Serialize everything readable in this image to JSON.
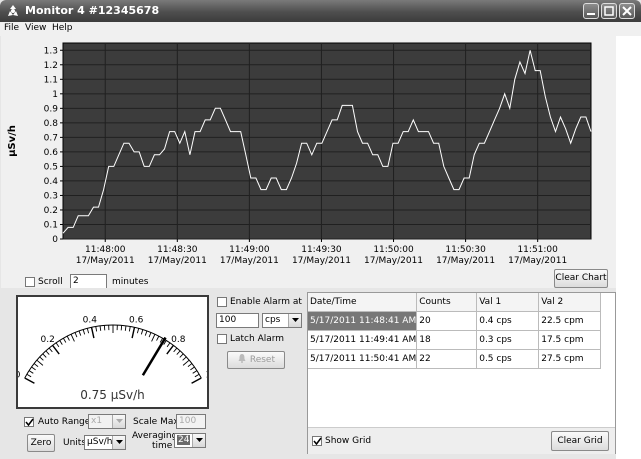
{
  "window": {
    "title": "Monitor 4 #12345678"
  },
  "menu": {
    "items": [
      "File",
      "View",
      "Help"
    ]
  },
  "chart_data": {
    "type": "line",
    "ylabel": "µSv/h",
    "ylim": [
      0,
      1.35
    ],
    "y_ticks": [
      "0",
      "0.1",
      "0.2",
      "0.3",
      "0.4",
      "0.5",
      "0.6",
      "0.7",
      "0.8",
      "0.9",
      "1",
      "1.1",
      "1.2",
      "1.3"
    ],
    "x_ticks": [
      {
        "time": "11:48:00",
        "date": "17/May/2011"
      },
      {
        "time": "11:48:30",
        "date": "17/May/2011"
      },
      {
        "time": "11:49:00",
        "date": "17/May/2011"
      },
      {
        "time": "11:49:30",
        "date": "17/May/2011"
      },
      {
        "time": "11:50:00",
        "date": "17/May/2011"
      },
      {
        "time": "11:50:30",
        "date": "17/May/2011"
      },
      {
        "time": "11:51:00",
        "date": "17/May/2011"
      }
    ],
    "grid": true,
    "background": "#3c3c3c",
    "line_color": "#ffffff",
    "series": [
      {
        "values": [
          0.04,
          0.08,
          0.08,
          0.16,
          0.16,
          0.16,
          0.22,
          0.22,
          0.34,
          0.5,
          0.5,
          0.58,
          0.66,
          0.66,
          0.6,
          0.6,
          0.5,
          0.5,
          0.58,
          0.58,
          0.62,
          0.74,
          0.74,
          0.66,
          0.74,
          0.58,
          0.74,
          0.74,
          0.82,
          0.82,
          0.9,
          0.9,
          0.82,
          0.74,
          0.74,
          0.74,
          0.58,
          0.42,
          0.42,
          0.34,
          0.34,
          0.42,
          0.42,
          0.34,
          0.34,
          0.42,
          0.52,
          0.66,
          0.66,
          0.58,
          0.66,
          0.66,
          0.74,
          0.82,
          0.82,
          0.92,
          0.92,
          0.92,
          0.74,
          0.66,
          0.66,
          0.58,
          0.58,
          0.5,
          0.5,
          0.66,
          0.66,
          0.74,
          0.74,
          0.82,
          0.74,
          0.74,
          0.74,
          0.66,
          0.66,
          0.5,
          0.42,
          0.34,
          0.34,
          0.42,
          0.42,
          0.58,
          0.66,
          0.66,
          0.74,
          0.82,
          0.9,
          1.0,
          0.9,
          1.1,
          1.22,
          1.14,
          1.3,
          1.16,
          1.16,
          0.98,
          0.84,
          0.74,
          0.84,
          0.76,
          0.66,
          0.76,
          0.84,
          0.84,
          0.74
        ]
      }
    ]
  },
  "scroll": {
    "label": "Scroll",
    "checked": false,
    "value": "2",
    "unit": "minutes"
  },
  "clear_chart": "Clear Chart",
  "gauge": {
    "value": 0.75,
    "min": 0,
    "max": 1,
    "display": "0.75 µSv/h",
    "labels": [
      "0",
      "0.2",
      "0.4",
      "0.6",
      "0.8",
      "1"
    ]
  },
  "auto_range": {
    "label": "Auto Range",
    "checked": true,
    "value": "x1"
  },
  "scale_max": {
    "label": "Scale Max",
    "value": "100"
  },
  "zero_button": "Zero",
  "units": {
    "label": "Units",
    "value": "µSv/h"
  },
  "averaging": {
    "label_line1": "Averaging",
    "label_line2": "time",
    "value": "24"
  },
  "alarm": {
    "enable_label": "Enable Alarm at",
    "enabled": false,
    "value": "100",
    "unit": "cps",
    "latch_label": "Latch Alarm",
    "latched": false,
    "reset_label": "Reset"
  },
  "grid": {
    "columns": [
      "Date/Time",
      "Counts",
      "Val 1",
      "Val 2"
    ],
    "rows": [
      [
        "5/17/2011 11:48:41 AM",
        "20",
        "0.4 cps",
        "22.5 cpm"
      ],
      [
        "5/17/2011 11:49:41 AM",
        "18",
        "0.3 cps",
        "17.5 cpm"
      ],
      [
        "5/17/2011 11:50:41 AM",
        "22",
        "0.5 cps",
        "27.5 cpm"
      ]
    ],
    "show_grid_label": "Show Grid",
    "show_grid": true,
    "clear_grid": "Clear Grid"
  }
}
